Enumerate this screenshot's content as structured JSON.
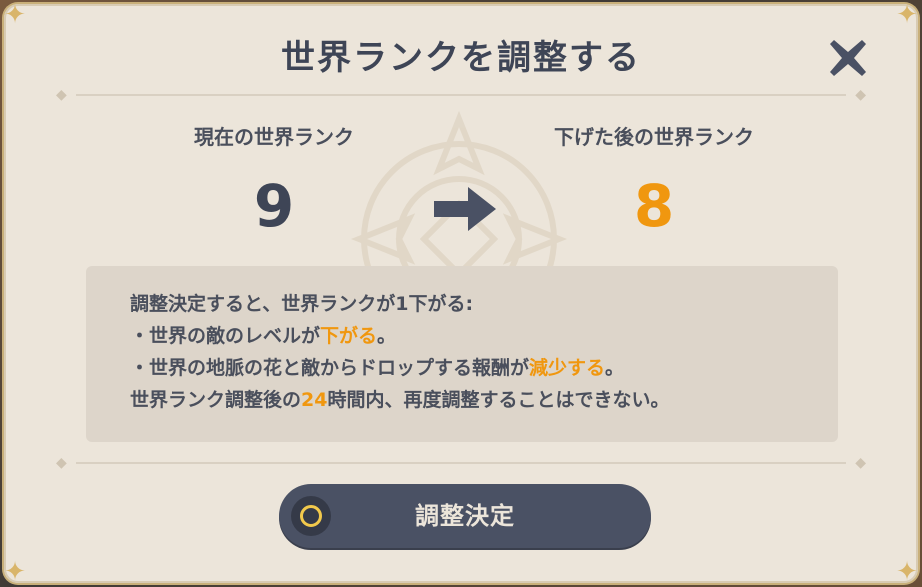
{
  "dialog": {
    "title": "世界ランクを調整する"
  },
  "rank": {
    "current_label": "現在の世界ランク",
    "current_value": "9",
    "lowered_label": "下げた後の世界ランク",
    "lowered_value": "8"
  },
  "info": {
    "line1": "調整決定すると、世界ランクが1下がる:",
    "line2_pre": "・世界の敵のレベルが",
    "line2_hl": "下がる",
    "line2_post": "。",
    "line3_pre": "・世界の地脈の花と敵からドロップする報酬が",
    "line3_hl": "減少する",
    "line3_post": "。",
    "line4_pre": "世界ランク調整後の",
    "line4_hl": "24",
    "line4_post": "時間内、再度調整することはできない。"
  },
  "confirm": {
    "label": "調整決定"
  },
  "icons": {
    "close": "close-x-icon",
    "arrow": "arrow-right-icon",
    "confirm": "confirm-circle-icon"
  },
  "colors": {
    "highlight": "#f0970f",
    "text": "#3e4556",
    "button": "#4a5164"
  }
}
